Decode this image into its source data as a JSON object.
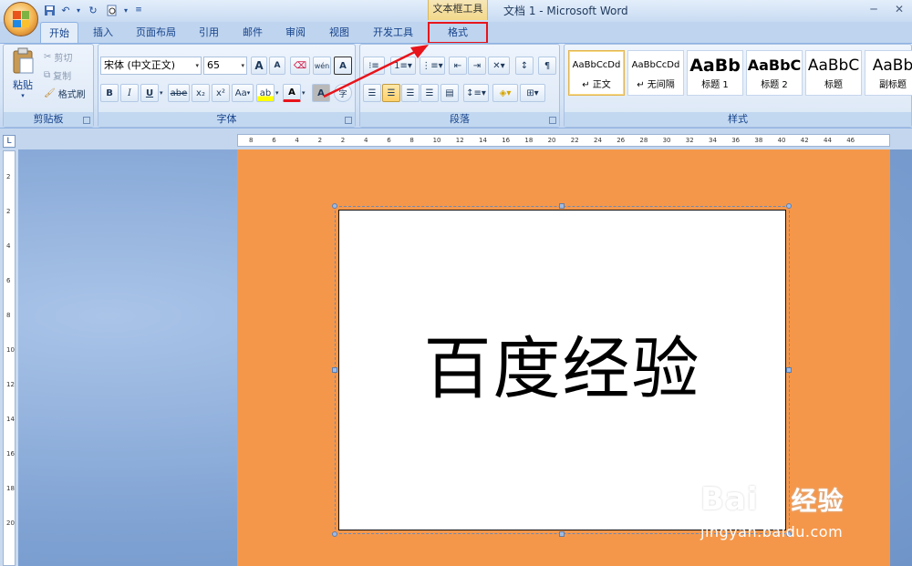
{
  "title_bar": {
    "context_group": "文本框工具",
    "doc_title": "文档 1 - Microsoft Word",
    "minimize": "─",
    "close": "✕"
  },
  "tabs": [
    "开始",
    "插入",
    "页面布局",
    "引用",
    "邮件",
    "审阅",
    "视图",
    "开发工具",
    "格式"
  ],
  "clipboard": {
    "paste": "粘贴",
    "cut": "剪切",
    "copy": "复制",
    "format_painter": "格式刷",
    "group": "剪贴板"
  },
  "font": {
    "name": "宋体 (中文正文)",
    "size": "65",
    "grow": "A",
    "shrink": "A",
    "phonetic": "wén",
    "border": "A",
    "bold": "B",
    "italic": "I",
    "underline": "U",
    "strike": "abe",
    "sub": "x₂",
    "sup": "x²",
    "case": "Aa",
    "highlight": "ab",
    "color": "A",
    "shading": "A",
    "enclose": "字",
    "group": "字体"
  },
  "paragraph": {
    "group": "段落"
  },
  "styles": {
    "group": "样式",
    "items": [
      {
        "sample": "AaBbCcDd",
        "name": "↵ 正文"
      },
      {
        "sample": "AaBbCcDd",
        "name": "↵ 无间隔"
      },
      {
        "sample": "AaBb",
        "name": "标题 1"
      },
      {
        "sample": "AaBbC",
        "name": "标题 2"
      },
      {
        "sample": "AaBbC",
        "name": "标题"
      },
      {
        "sample": "AaBb",
        "name": "副标题"
      }
    ]
  },
  "ruler": {
    "top_labels": [
      "8",
      "6",
      "4",
      "2",
      "2",
      "4",
      "6",
      "8",
      "10",
      "12",
      "14",
      "16",
      "18",
      "20",
      "22",
      "24",
      "26",
      "28",
      "30",
      "32",
      "34",
      "36",
      "38",
      "40",
      "42",
      "44",
      "46"
    ],
    "left_labels": [
      "2",
      "2",
      "4",
      "6",
      "8",
      "10",
      "12",
      "14",
      "16",
      "18",
      "20"
    ],
    "corner": "L"
  },
  "document": {
    "textbox_text": "百度经验"
  },
  "watermark": {
    "brand": "Bai",
    "brand_cn": "经验",
    "url": "jingyan.baidu.com"
  },
  "colors": {
    "page_background": "#f5974a",
    "highlight_box": "#e8141b",
    "annotation_arrow": "#e8141b"
  }
}
